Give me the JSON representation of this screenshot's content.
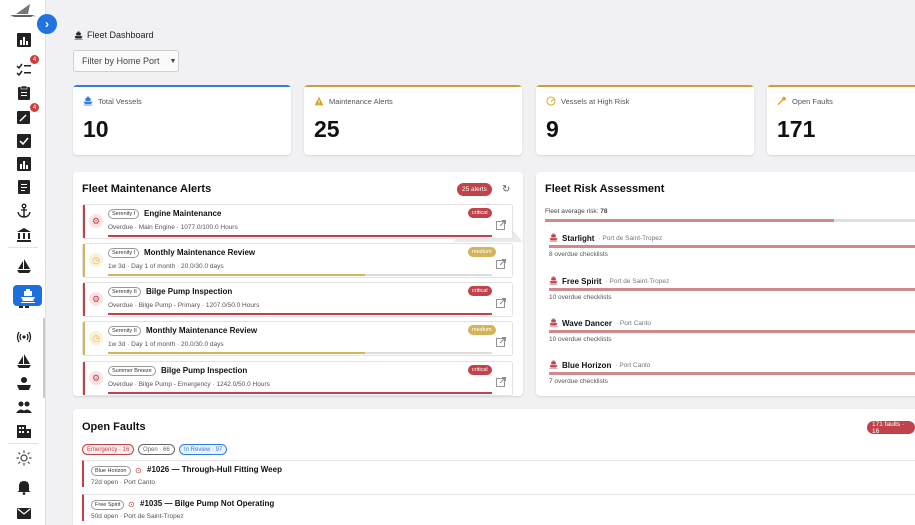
{
  "header": {
    "title": "Fleet Dashboard"
  },
  "filter": {
    "label": "Filter by Home Port"
  },
  "sidebar": {
    "badges": {
      "checklists": "4",
      "tasks": "4"
    }
  },
  "stats": [
    {
      "label": "Total Vessels",
      "value": "10",
      "icon": "ship-icon",
      "color": "#2f7de1"
    },
    {
      "label": "Maintenance Alerts",
      "value": "25",
      "icon": "warning-icon",
      "color": "#c9a23f"
    },
    {
      "label": "Vessels at High Risk",
      "value": "9",
      "icon": "gauge-icon",
      "color": "#c9a23f"
    },
    {
      "label": "Open Faults",
      "value": "171",
      "icon": "wrench-icon",
      "color": "#c9a23f"
    }
  ],
  "alerts_panel": {
    "title": "Fleet Maintenance Alerts",
    "count": "25 alerts",
    "items": [
      {
        "vessel": "Serenity I",
        "title": "Engine Maintenance",
        "sub": "Overdue · Main Engine · 1077.0/100.0 Hours",
        "severity": "critical",
        "progress": 1.0
      },
      {
        "vessel": "Serenity I",
        "title": "Monthly Maintenance Review",
        "sub": "1w 3d · Day 1 of month · 20.0/30.0 days",
        "severity": "medium",
        "progress": 0.67
      },
      {
        "vessel": "Serenity II",
        "title": "Bilge Pump Inspection",
        "sub": "Overdue · Bilge Pump - Primary · 1207.0/50.0 Hours",
        "severity": "critical",
        "progress": 1.0
      },
      {
        "vessel": "Serenity II",
        "title": "Monthly Maintenance Review",
        "sub": "1w 3d · Day 1 of month · 20.0/30.0 days",
        "severity": "medium",
        "progress": 0.67
      },
      {
        "vessel": "Summer Breeze",
        "title": "Bilge Pump Inspection",
        "sub": "Overdue · Bilge Pump - Emergency · 1242.0/50.0 Hours",
        "severity": "critical",
        "progress": 1.0
      }
    ]
  },
  "risk_panel": {
    "title": "Fleet Risk Assessment",
    "average_label": "Fleet average risk:",
    "average_value": "78",
    "average_fraction": 0.78,
    "items": [
      {
        "name": "Starlight",
        "port": "Port de Saint-Tropez",
        "count": "8 overdue checklists"
      },
      {
        "name": "Free Spirit",
        "port": "Port de Saint-Tropez",
        "count": "10 overdue checklists"
      },
      {
        "name": "Wave Dancer",
        "port": "Port Canto",
        "count": "10 overdue checklists"
      },
      {
        "name": "Blue Horizon",
        "port": "Port Canto",
        "count": "7 overdue checklists"
      }
    ]
  },
  "faults_panel": {
    "title": "Open Faults",
    "count": "171 faults · 16",
    "filters": [
      {
        "label": "Emergency · 16",
        "color": "#c0434b"
      },
      {
        "label": "Open · 66",
        "color": "#666666"
      },
      {
        "label": "In Review · 97",
        "color": "#2f7de1"
      }
    ],
    "items": [
      {
        "vessel": "Blue Horizon",
        "title": "#1026 — Through-Hull Fitting Weep",
        "sub": "72d open · Port Canto"
      },
      {
        "vessel": "Free Spirit",
        "title": "#1035 — Bilge Pump Not Operating",
        "sub": "50d open · Port de Saint-Tropez"
      }
    ]
  },
  "colors": {
    "critical": "#c0434b",
    "medium": "#d4b45a",
    "accent": "#1e6fd9"
  }
}
